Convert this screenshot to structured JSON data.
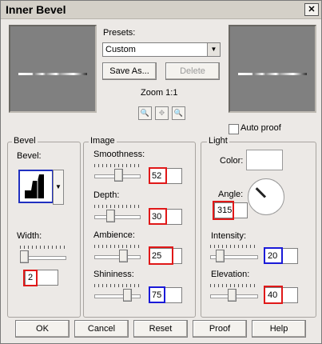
{
  "window": {
    "title": "Inner Bevel",
    "close_icon": "close-icon"
  },
  "presets": {
    "label": "Presets:",
    "value": "Custom",
    "save_as": "Save As...",
    "delete": "Delete"
  },
  "zoom": {
    "label": "Zoom 1:1",
    "zoom_out_icon": "zoom-out-icon",
    "pan_icon": "pan-icon",
    "zoom_in_icon": "zoom-in-icon"
  },
  "auto_proof": {
    "label": "Auto proof",
    "checked": false
  },
  "bevel": {
    "group": "Bevel",
    "bevel_label": "Bevel:",
    "width_label": "Width:",
    "width_value": "2"
  },
  "image": {
    "group": "Image",
    "smoothness_label": "Smoothness:",
    "smoothness_value": "52",
    "depth_label": "Depth:",
    "depth_value": "30",
    "ambience_label": "Ambience:",
    "ambience_value": "25",
    "shininess_label": "Shininess:",
    "shininess_value": "75"
  },
  "light": {
    "group": "Light",
    "color_label": "Color:",
    "color": "#ffffff",
    "angle_label": "Angle:",
    "angle_value": "315",
    "intensity_label": "Intensity:",
    "intensity_value": "20",
    "elevation_label": "Elevation:",
    "elevation_value": "40"
  },
  "buttons": {
    "ok": "OK",
    "cancel": "Cancel",
    "reset": "Reset",
    "proof": "Proof",
    "help": "Help"
  },
  "colors": {
    "highlight_red": "#e01818",
    "highlight_blue": "#1a1ad8",
    "dialog_bg": "#ece9e6"
  }
}
